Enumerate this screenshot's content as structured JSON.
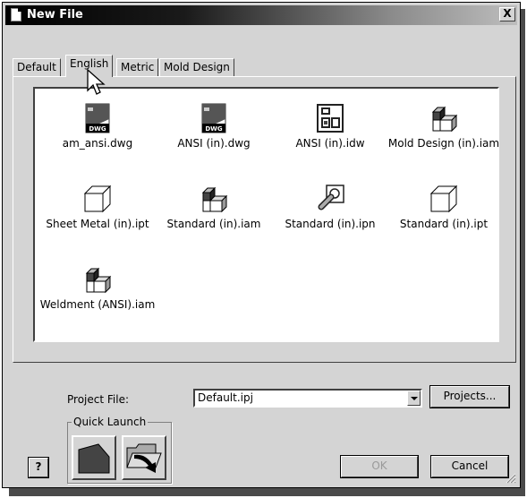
{
  "window": {
    "title": "New File",
    "close_label": "X"
  },
  "tabs": [
    {
      "label": "Default",
      "active": false
    },
    {
      "label": "English",
      "active": true
    },
    {
      "label": "Metric",
      "active": false
    },
    {
      "label": "Mold Design",
      "active": false
    }
  ],
  "files": [
    {
      "name": "am_ansi.dwg",
      "icon": "dwg-file-icon"
    },
    {
      "name": "ANSI (in).dwg",
      "icon": "dwg-file-icon"
    },
    {
      "name": "ANSI (in).idw",
      "icon": "drawing-file-icon"
    },
    {
      "name": "Mold Design (in).iam",
      "icon": "assembly-file-icon"
    },
    {
      "name": "Sheet Metal (in).ipt",
      "icon": "part-file-icon"
    },
    {
      "name": "Standard (in).iam",
      "icon": "assembly-file-icon"
    },
    {
      "name": "Standard (in).ipn",
      "icon": "presentation-file-icon"
    },
    {
      "name": "Standard (in).ipt",
      "icon": "part-file-icon"
    },
    {
      "name": "Weldment (ANSI).iam",
      "icon": "assembly-file-icon"
    }
  ],
  "dwg_badge": "DWG",
  "project": {
    "label": "Project File:",
    "value": "Default.ipj",
    "projects_button": "Projects..."
  },
  "quick_launch": {
    "legend": "Quick Launch"
  },
  "buttons": {
    "help": "?",
    "ok": "OK",
    "cancel": "Cancel"
  }
}
